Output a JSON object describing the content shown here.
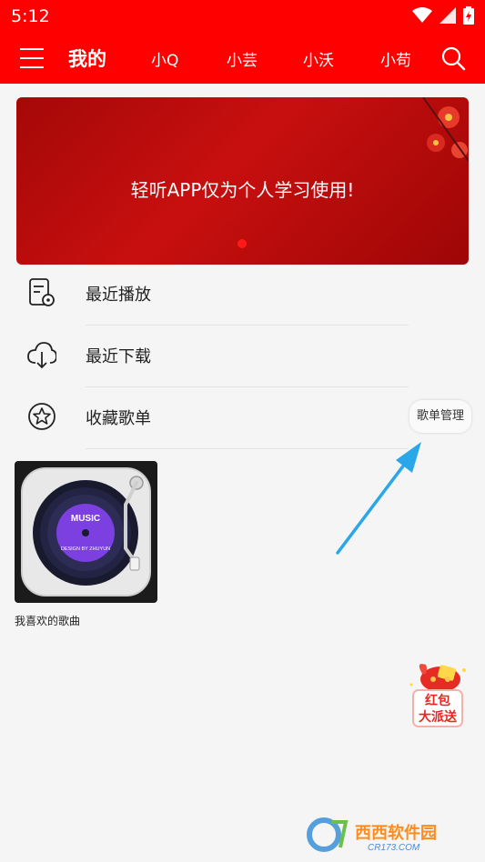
{
  "status_bar": {
    "time": "5:12"
  },
  "header": {
    "tabs": [
      {
        "label": "我的",
        "active": true
      },
      {
        "label": "小Q"
      },
      {
        "label": "小芸"
      },
      {
        "label": "小沃"
      },
      {
        "label": "小苟"
      }
    ]
  },
  "banner": {
    "text": "轻听APP仅为个人学习使用!"
  },
  "menu": [
    {
      "label": "最近播放",
      "icon": "recent-play-icon"
    },
    {
      "label": "最近下载",
      "icon": "download-icon"
    },
    {
      "label": "收藏歌单",
      "icon": "star-icon"
    }
  ],
  "manage_button": {
    "label": "歌单管理"
  },
  "playlists": [
    {
      "title": "我喜欢的歌曲",
      "cover_text_main": "MUSIC",
      "cover_text_sub": "DESIGN BY ZHUYUN"
    }
  ],
  "redpack": {
    "line1": "红包",
    "line2": "大派送"
  },
  "watermark": {
    "text_a": "西西软件园",
    "text_b": "CR173.COM"
  },
  "colors": {
    "header_red": "#ff0000",
    "banner_red": "#b40c0c",
    "arrow_blue": "#2aa7e8",
    "disc_purple": "#7c3fe0"
  }
}
